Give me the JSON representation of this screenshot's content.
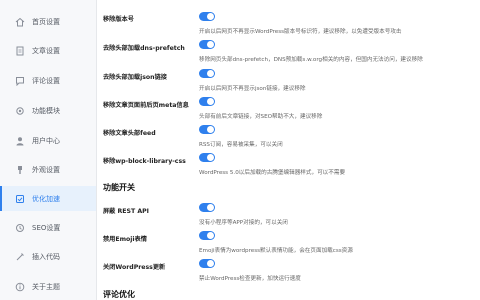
{
  "sidebar": {
    "items": [
      {
        "label": "首页设置",
        "icon": "home-icon"
      },
      {
        "label": "文章设置",
        "icon": "document-icon"
      },
      {
        "label": "评论设置",
        "icon": "comment-icon"
      },
      {
        "label": "功能模块",
        "icon": "gear-icon"
      },
      {
        "label": "用户中心",
        "icon": "user-icon"
      },
      {
        "label": "外观设置",
        "icon": "brush-icon"
      },
      {
        "label": "优化加速",
        "icon": "speed-icon",
        "active": true
      },
      {
        "label": "SEO设置",
        "icon": "seo-icon"
      },
      {
        "label": "插入代码",
        "icon": "code-icon"
      },
      {
        "label": "关于主题",
        "icon": "info-icon"
      }
    ]
  },
  "settings": [
    {
      "title": "移除版本号",
      "enabled": true,
      "desc": "开启以后网页不再显示WordPress版本号标识符，建议移除，以免遭受版本号攻击"
    },
    {
      "title": "去除头部加载dns-prefetch",
      "enabled": true,
      "desc": "移除网页头部dns-prefetch，DNS预加载s.w.org相关的内容，但国内无法访问，建议移除"
    },
    {
      "title": "去除头部加载json链接",
      "enabled": true,
      "desc": "开启以后网页不再显示json链接，建议移除"
    },
    {
      "title": "移除文章页面前后页meta信息",
      "enabled": true,
      "desc": "头部有前后文章链接，对SEO帮助不大，建议移除"
    },
    {
      "title": "移除文章头部feed",
      "enabled": true,
      "desc": "RSS订阅，容易被采集，可以关闭"
    },
    {
      "title": "移除wp-block-library-css",
      "enabled": true,
      "desc": "WordPress 5.0以后加载的古腾堡编辑器样式，可以不需要"
    }
  ],
  "sections": {
    "features": "功能开关",
    "comments": "评论优化"
  },
  "feature_settings": [
    {
      "title": "屏蔽 REST API",
      "enabled": true,
      "desc": "没有小程序等APP对接的，可以关闭"
    },
    {
      "title": "禁用Emoji表情",
      "enabled": true,
      "desc": "Emoji表情为wordpress默认表情功能，会在页面加载css资源"
    },
    {
      "title": "关闭WordPress更新",
      "enabled": true,
      "desc": "禁止WordPress检查更新，加快运行速度"
    }
  ],
  "colors": {
    "accent": "#2f80ed",
    "sidebar_bg": "#f7f8fa",
    "active_bg": "#e7f1fc"
  }
}
